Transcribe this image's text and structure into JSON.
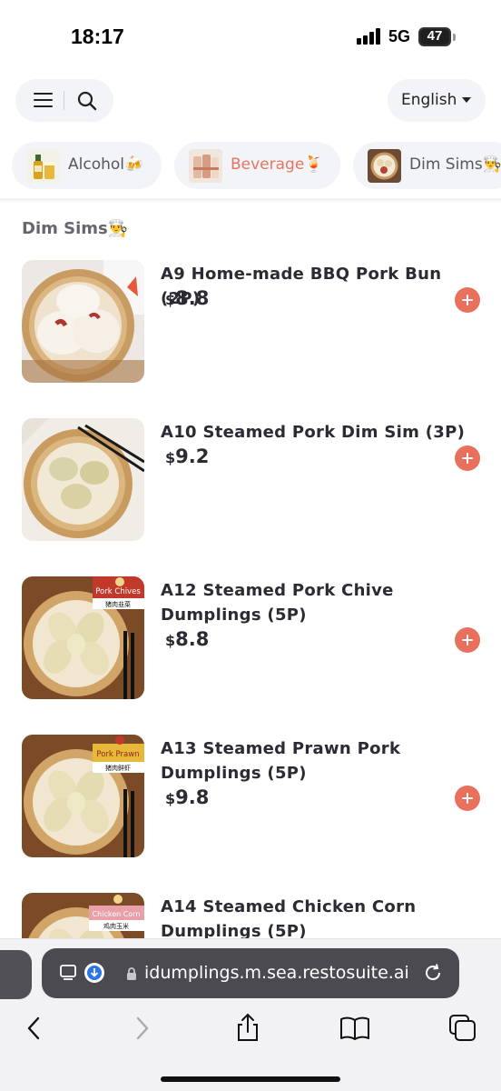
{
  "status_bar": {
    "time": "18:17",
    "network": "5G",
    "battery": "47"
  },
  "header": {
    "menu_icon": "hamburger-menu-icon",
    "search_icon": "search-icon",
    "language": "English"
  },
  "category_tabs": [
    {
      "label": "Alcohol🍻",
      "active": false
    },
    {
      "label": "Beverage🍹",
      "active": true
    },
    {
      "label": "Dim Sims👨‍🍳",
      "active": false
    }
  ],
  "section": {
    "title": "Dim Sims👨‍🍳"
  },
  "menu_items": [
    {
      "name": "A9 Home-made BBQ Pork Bun (2P)",
      "currency": "$",
      "price": "8.8"
    },
    {
      "name": "A10 Steamed Pork Dim Sim (3P)",
      "currency": "$",
      "price": "9.2"
    },
    {
      "name": "A12 Steamed Pork Chive Dumplings (5P)",
      "currency": "$",
      "price": "8.8",
      "photo_label": "Pork Chives",
      "photo_sub": "猪肉韭菜"
    },
    {
      "name": "A13 Steamed Prawn Pork Dumplings (5P)",
      "currency": "$",
      "price": "9.8",
      "photo_label": "Pork Prawn",
      "photo_sub": "猪肉鲜虾"
    },
    {
      "name": "A14 Steamed Chicken Corn Dumplings (5P)",
      "photo_label": "Chicken Corn",
      "photo_sub": "鸡肉玉米"
    }
  ],
  "browser": {
    "url": "idumplings.m.sea.restosuite.ai",
    "nav_icons": [
      "back-icon",
      "forward-icon",
      "share-icon",
      "bookmarks-icon",
      "tabs-icon"
    ]
  },
  "colors": {
    "accent": "#e8705c",
    "pill_bg": "#f3f4f7",
    "text": "#2b2b33"
  }
}
